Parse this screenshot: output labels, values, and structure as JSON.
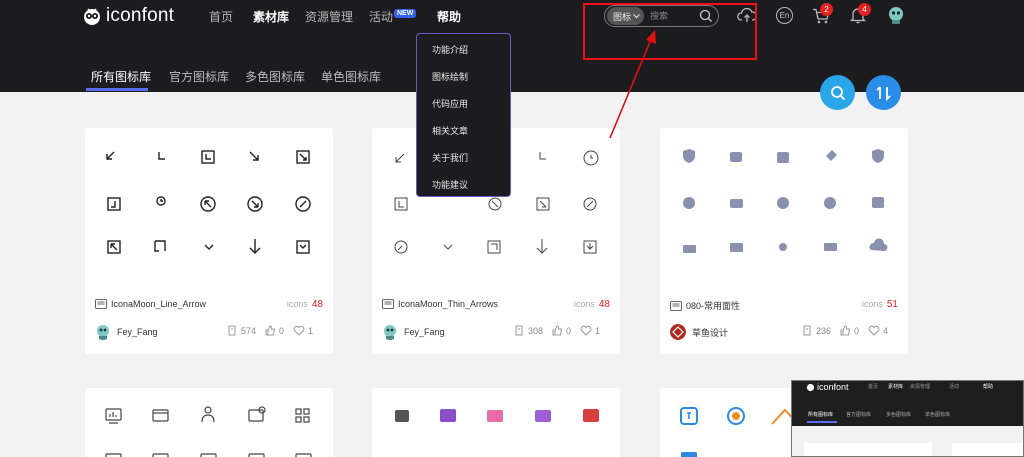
{
  "brand": {
    "name": "iconfont"
  },
  "nav": [
    {
      "label": "首页",
      "active": false
    },
    {
      "label": "素材库",
      "active": true
    },
    {
      "label": "资源管理",
      "active": false
    },
    {
      "label": "活动",
      "active": false,
      "badge": "NEW"
    },
    {
      "label": "帮助",
      "active": true
    }
  ],
  "search": {
    "type_label": "图标",
    "placeholder": "搜索"
  },
  "header_icons": {
    "lang": "En",
    "cart_count": "2",
    "bell_count": "4"
  },
  "tabs": [
    "所有图标库",
    "官方图标库",
    "多色图标库",
    "单色图标库"
  ],
  "help_menu": [
    "功能介绍",
    "图标绘制",
    "代码应用",
    "相关文章",
    "关于我们",
    "功能建议"
  ],
  "cards": [
    {
      "title": "IconaMoon_Line_Arrow",
      "icons_label": "icons",
      "count": "48",
      "author": "Fey_Fang",
      "collects": "574",
      "likes": "0",
      "favs": "1"
    },
    {
      "title": "IconaMoon_Thin_Arrows",
      "icons_label": "icons",
      "count": "48",
      "author": "Fey_Fang",
      "collects": "308",
      "likes": "0",
      "favs": "1"
    },
    {
      "title": "080-常用面性",
      "icons_label": "icons",
      "count": "51",
      "author": "草鱼设计",
      "collects": "236",
      "likes": "0",
      "favs": "4"
    }
  ],
  "thumbnail": {
    "brand": "iconfont",
    "nav": [
      "首页",
      "素材库",
      "资源管理",
      "活动",
      "帮助"
    ],
    "tabs": [
      "所有图标库",
      "官方图标库",
      "多色图标库",
      "单色图标库"
    ]
  },
  "colors": {
    "accent": "#5a6cf2",
    "fab": "#2aa6e8",
    "annotation": "#e11111",
    "count": "#e52121",
    "bg": "#1c1c1e"
  }
}
